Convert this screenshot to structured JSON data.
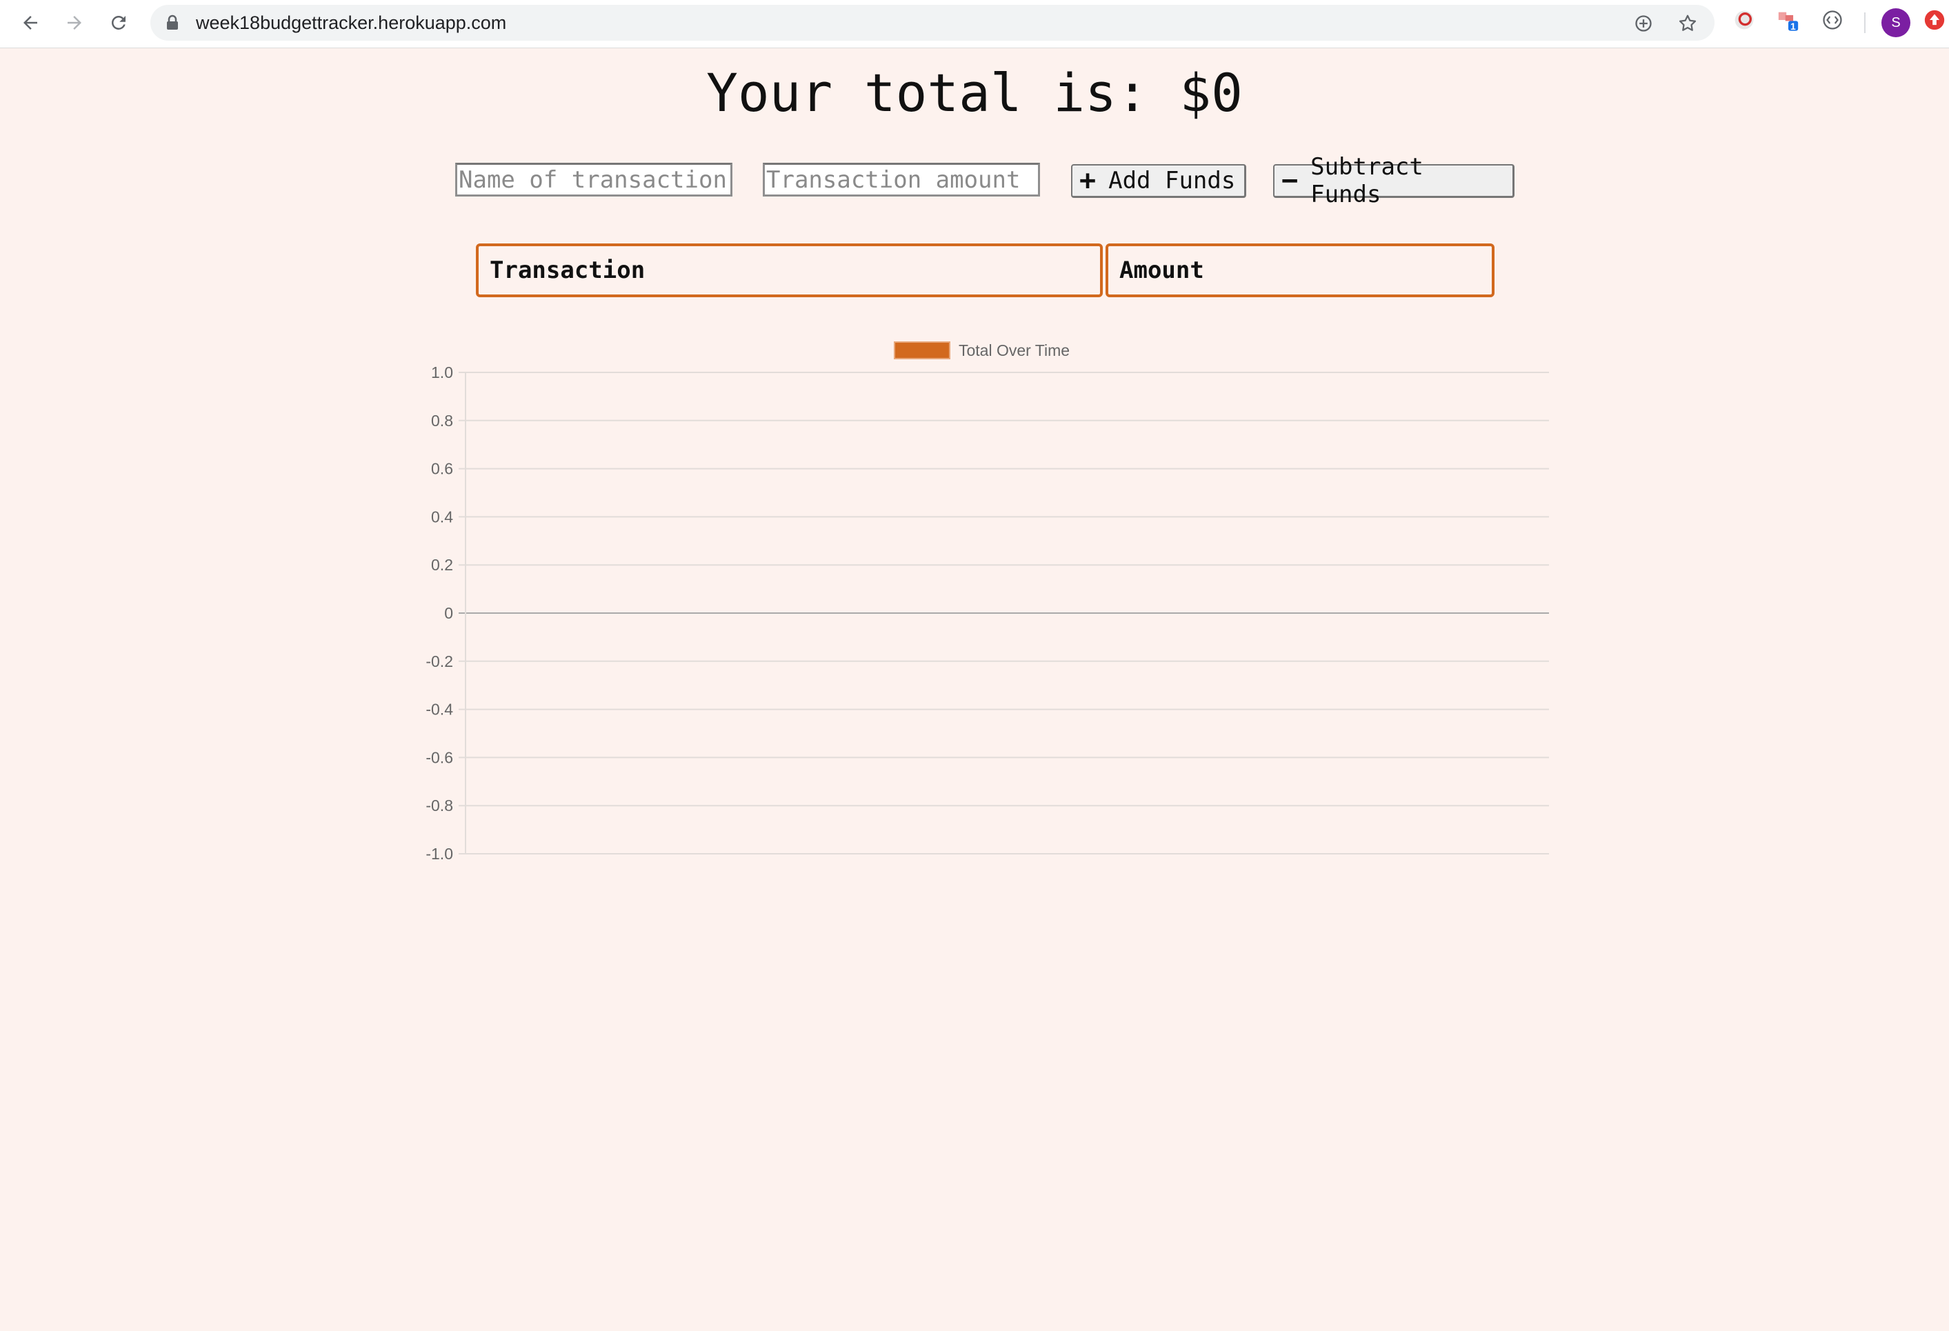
{
  "browser": {
    "url": "week18budgettracker.herokuapp.com",
    "profile_initial": "S",
    "extension_badge": "1"
  },
  "page": {
    "total_text": "Your total is: $0",
    "name_placeholder": "Name of transaction",
    "amount_placeholder": "Transaction amount",
    "add_label": "Add Funds",
    "subtract_label": "Subtract Funds",
    "add_icon": "+",
    "subtract_icon": "−"
  },
  "table": {
    "headers": [
      "Transaction",
      "Amount"
    ],
    "rows": []
  },
  "colors": {
    "accent": "#d2691e",
    "background": "#fdf2ee"
  },
  "chart_data": {
    "type": "line",
    "title": "",
    "legend": "top",
    "series": [
      {
        "name": "Total Over Time",
        "values": []
      }
    ],
    "x": [],
    "ylim": [
      -1.0,
      1.0
    ],
    "yticks": [
      "1.0",
      "0.8",
      "0.6",
      "0.4",
      "0.2",
      "0",
      "-0.2",
      "-0.4",
      "-0.6",
      "-0.8",
      "-1.0"
    ],
    "grid": true
  }
}
